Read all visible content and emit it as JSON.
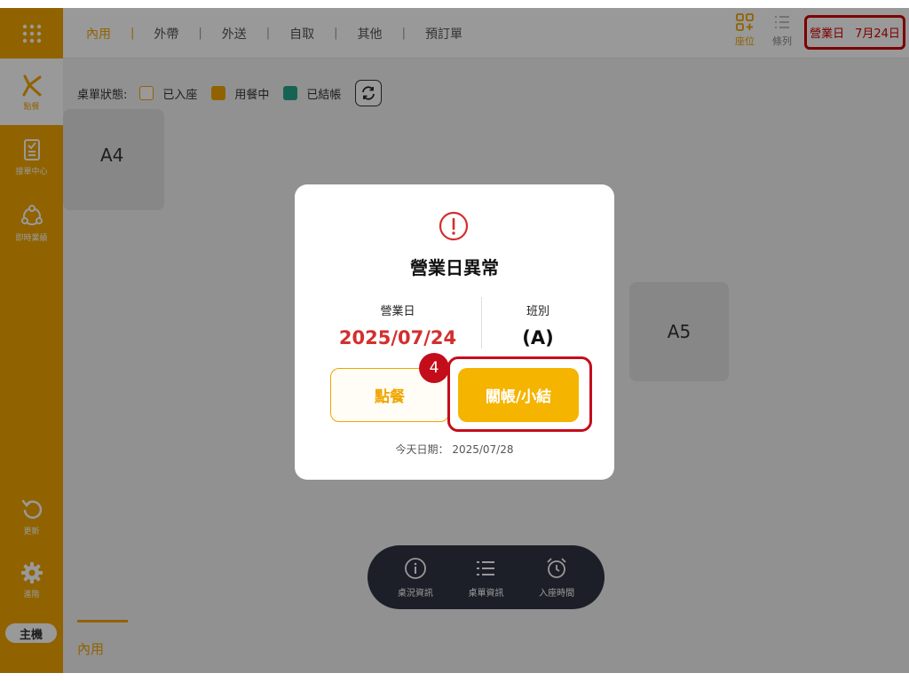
{
  "top_tabs": [
    {
      "label": "內用"
    },
    {
      "label": "外帶"
    },
    {
      "label": "外送"
    },
    {
      "label": "自取"
    },
    {
      "label": "其他"
    },
    {
      "label": "預訂單"
    }
  ],
  "view_toggles": {
    "seat": "座位",
    "list": "條列"
  },
  "business_day": {
    "label": "營業日",
    "value": "7月24日"
  },
  "sidebar": {
    "order": "點餐",
    "orders_center": "接單中心",
    "realtime": "即時業績",
    "update": "更新",
    "settings": "進階",
    "host": "主機"
  },
  "legend": {
    "label": "桌單狀態:",
    "items": [
      {
        "label": "已入座",
        "color": "#ffffff",
        "border": "#f0a500"
      },
      {
        "label": "用餐中",
        "color": "#f0a500",
        "border": "#f0a500"
      },
      {
        "label": "已結帳",
        "color": "#26a58a",
        "border": "#26a58a"
      }
    ]
  },
  "tables": [
    {
      "name": "A4"
    },
    {
      "name": "A5"
    }
  ],
  "bottom_bar": [
    {
      "label": "桌況資訊",
      "icon": "info-icon"
    },
    {
      "label": "桌單資訊",
      "icon": "list-icon"
    },
    {
      "label": "入座時間",
      "icon": "alarm-icon"
    }
  ],
  "bottom_tab": {
    "label": "內用"
  },
  "modal": {
    "icon": "alert-icon",
    "title": "營業日異常",
    "biz_day_label": "營業日",
    "biz_day_value": "2025/07/24",
    "shift_label": "班別",
    "shift_value": "(A)",
    "order_button": "點餐",
    "close_button": "關帳/小結",
    "step_number": "4",
    "today": "今天日期： 2025/07/28"
  },
  "colors": {
    "accent": "#f0a500",
    "alert": "#d32f2f",
    "highlight": "#c40d1b"
  }
}
